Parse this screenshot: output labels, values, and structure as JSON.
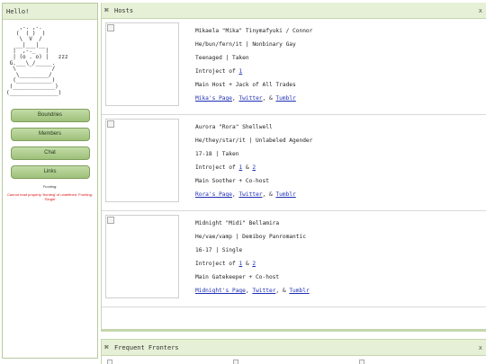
{
  "sidebar": {
    "title": "Hello!",
    "ascii_art": "    ,-. ,-.\n   (  ( )  )\n    \\  V  /\n   __|___|__\n  |  ,-._   |\n  | (o . o) |   zzz\n G.___\\_/_____.\n  \\           /\n   \\_________/\n  (___________)\n (_____________)\n(_______________)",
    "nav": [
      "Boundries",
      "Members",
      "Chat",
      "Links"
    ],
    "status": "Fronting:",
    "error": "Cannot read property 'fronting' of undefined. Fronting: 'Single'"
  },
  "hosts_window": {
    "title": "Hosts",
    "close": "x",
    "hosts": [
      {
        "name": "Mikaela \"Mika\" Tinymafyuki / Connor",
        "pronouns": "He/bun/fern/it | Nonbinary Gay",
        "age": "Teenaged | Taken",
        "introject_prefix": "Introject of ",
        "introject_links": [
          "1"
        ],
        "role": "Main Host + Jack of All Trades",
        "page_link": "Mika's Page",
        "twitter": "Twitter",
        "tumblr": "Tumblr"
      },
      {
        "name": "Aurora \"Rora\" Shellwell",
        "pronouns": "He/they/star/it | Unlabeled Agender",
        "age": "17-18 | Taken",
        "introject_prefix": "Introject of ",
        "introject_links": [
          "1",
          "2"
        ],
        "role": "Main Soother + Co-host",
        "page_link": "Rora's Page",
        "twitter": "Twitter",
        "tumblr": "Tumblr"
      },
      {
        "name": "Midnight \"Midi\" Bellamira",
        "pronouns": "He/vae/vamp | Demiboy Panromantic",
        "age": "16-17 | Single",
        "introject_prefix": "Introject of ",
        "introject_links": [
          "1",
          "2"
        ],
        "role": "Main Gatekeeper + Co-host",
        "page_link": "Midnight's Page",
        "twitter": "Twitter",
        "tumblr": "Tumblr"
      }
    ]
  },
  "fronters_window": {
    "title": "Frequent Fronters",
    "close": "x"
  }
}
